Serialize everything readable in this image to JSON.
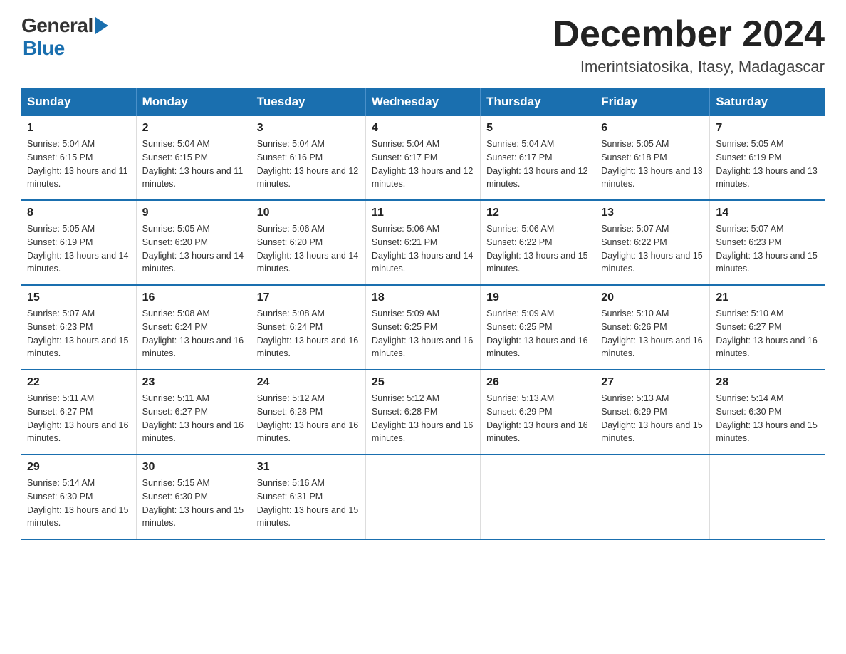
{
  "header": {
    "logo_general": "General",
    "logo_blue": "Blue",
    "title": "December 2024",
    "subtitle": "Imerintsiatosika, Itasy, Madagascar"
  },
  "weekdays": [
    "Sunday",
    "Monday",
    "Tuesday",
    "Wednesday",
    "Thursday",
    "Friday",
    "Saturday"
  ],
  "weeks": [
    [
      {
        "day": "1",
        "sunrise": "5:04 AM",
        "sunset": "6:15 PM",
        "daylight": "13 hours and 11 minutes."
      },
      {
        "day": "2",
        "sunrise": "5:04 AM",
        "sunset": "6:15 PM",
        "daylight": "13 hours and 11 minutes."
      },
      {
        "day": "3",
        "sunrise": "5:04 AM",
        "sunset": "6:16 PM",
        "daylight": "13 hours and 12 minutes."
      },
      {
        "day": "4",
        "sunrise": "5:04 AM",
        "sunset": "6:17 PM",
        "daylight": "13 hours and 12 minutes."
      },
      {
        "day": "5",
        "sunrise": "5:04 AM",
        "sunset": "6:17 PM",
        "daylight": "13 hours and 12 minutes."
      },
      {
        "day": "6",
        "sunrise": "5:05 AM",
        "sunset": "6:18 PM",
        "daylight": "13 hours and 13 minutes."
      },
      {
        "day": "7",
        "sunrise": "5:05 AM",
        "sunset": "6:19 PM",
        "daylight": "13 hours and 13 minutes."
      }
    ],
    [
      {
        "day": "8",
        "sunrise": "5:05 AM",
        "sunset": "6:19 PM",
        "daylight": "13 hours and 14 minutes."
      },
      {
        "day": "9",
        "sunrise": "5:05 AM",
        "sunset": "6:20 PM",
        "daylight": "13 hours and 14 minutes."
      },
      {
        "day": "10",
        "sunrise": "5:06 AM",
        "sunset": "6:20 PM",
        "daylight": "13 hours and 14 minutes."
      },
      {
        "day": "11",
        "sunrise": "5:06 AM",
        "sunset": "6:21 PM",
        "daylight": "13 hours and 14 minutes."
      },
      {
        "day": "12",
        "sunrise": "5:06 AM",
        "sunset": "6:22 PM",
        "daylight": "13 hours and 15 minutes."
      },
      {
        "day": "13",
        "sunrise": "5:07 AM",
        "sunset": "6:22 PM",
        "daylight": "13 hours and 15 minutes."
      },
      {
        "day": "14",
        "sunrise": "5:07 AM",
        "sunset": "6:23 PM",
        "daylight": "13 hours and 15 minutes."
      }
    ],
    [
      {
        "day": "15",
        "sunrise": "5:07 AM",
        "sunset": "6:23 PM",
        "daylight": "13 hours and 15 minutes."
      },
      {
        "day": "16",
        "sunrise": "5:08 AM",
        "sunset": "6:24 PM",
        "daylight": "13 hours and 16 minutes."
      },
      {
        "day": "17",
        "sunrise": "5:08 AM",
        "sunset": "6:24 PM",
        "daylight": "13 hours and 16 minutes."
      },
      {
        "day": "18",
        "sunrise": "5:09 AM",
        "sunset": "6:25 PM",
        "daylight": "13 hours and 16 minutes."
      },
      {
        "day": "19",
        "sunrise": "5:09 AM",
        "sunset": "6:25 PM",
        "daylight": "13 hours and 16 minutes."
      },
      {
        "day": "20",
        "sunrise": "5:10 AM",
        "sunset": "6:26 PM",
        "daylight": "13 hours and 16 minutes."
      },
      {
        "day": "21",
        "sunrise": "5:10 AM",
        "sunset": "6:27 PM",
        "daylight": "13 hours and 16 minutes."
      }
    ],
    [
      {
        "day": "22",
        "sunrise": "5:11 AM",
        "sunset": "6:27 PM",
        "daylight": "13 hours and 16 minutes."
      },
      {
        "day": "23",
        "sunrise": "5:11 AM",
        "sunset": "6:27 PM",
        "daylight": "13 hours and 16 minutes."
      },
      {
        "day": "24",
        "sunrise": "5:12 AM",
        "sunset": "6:28 PM",
        "daylight": "13 hours and 16 minutes."
      },
      {
        "day": "25",
        "sunrise": "5:12 AM",
        "sunset": "6:28 PM",
        "daylight": "13 hours and 16 minutes."
      },
      {
        "day": "26",
        "sunrise": "5:13 AM",
        "sunset": "6:29 PM",
        "daylight": "13 hours and 16 minutes."
      },
      {
        "day": "27",
        "sunrise": "5:13 AM",
        "sunset": "6:29 PM",
        "daylight": "13 hours and 15 minutes."
      },
      {
        "day": "28",
        "sunrise": "5:14 AM",
        "sunset": "6:30 PM",
        "daylight": "13 hours and 15 minutes."
      }
    ],
    [
      {
        "day": "29",
        "sunrise": "5:14 AM",
        "sunset": "6:30 PM",
        "daylight": "13 hours and 15 minutes."
      },
      {
        "day": "30",
        "sunrise": "5:15 AM",
        "sunset": "6:30 PM",
        "daylight": "13 hours and 15 minutes."
      },
      {
        "day": "31",
        "sunrise": "5:16 AM",
        "sunset": "6:31 PM",
        "daylight": "13 hours and 15 minutes."
      },
      null,
      null,
      null,
      null
    ]
  ]
}
